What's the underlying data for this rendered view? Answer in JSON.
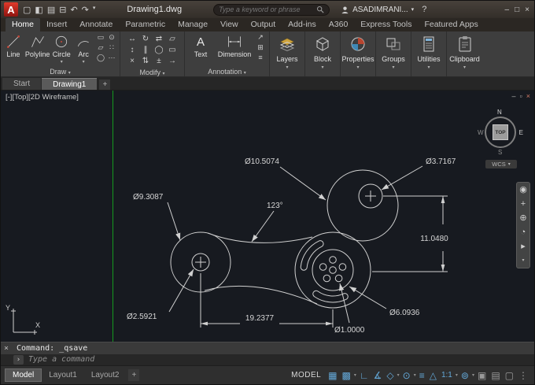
{
  "titlebar": {
    "logo": "A",
    "title": "Drawing1.dwg",
    "search_placeholder": "Type a keyword or phrase",
    "user": "ASADIMRANI..."
  },
  "ribbon": {
    "tabs": [
      "Home",
      "Insert",
      "Annotate",
      "Parametric",
      "Manage",
      "View",
      "Output",
      "Add-ins",
      "A360",
      "Express Tools",
      "Featured Apps"
    ],
    "draw": {
      "label": "Draw",
      "tools": [
        "Line",
        "Polyline",
        "Circle",
        "Arc"
      ]
    },
    "modify": {
      "label": "Modify"
    },
    "annotation": {
      "label": "Annotation",
      "tools": [
        "Text",
        "Dimension"
      ]
    },
    "panels": [
      "Layers",
      "Block",
      "Properties",
      "Groups",
      "Utilities",
      "Clipboard"
    ]
  },
  "filetabs": {
    "start": "Start",
    "drawing": "Drawing1",
    "add": "+"
  },
  "viewport": {
    "label": "[-][Top][2D Wireframe]",
    "viewcube": {
      "n": "N",
      "s": "S",
      "e": "E",
      "w": "W",
      "top": "TOP",
      "wcs": "WCS"
    },
    "ucs_x": "X",
    "ucs_y": "Y"
  },
  "drawing": {
    "dims": {
      "big_top": "Ø10.5074",
      "small_top": "Ø3.7167",
      "left_outer": "Ø9.3087",
      "left_inner": "Ø2.5921",
      "width": "19.2377",
      "height": "11.0480",
      "hub_inner": "Ø6.0936",
      "hole": "Ø1.0000",
      "angle": "123°"
    }
  },
  "command": {
    "history": "Command: _qsave",
    "prompt": "Type a command"
  },
  "statusbar": {
    "layouts": [
      "Model",
      "Layout1",
      "Layout2"
    ],
    "add": "+",
    "model": "MODEL",
    "scale": "1:1"
  }
}
